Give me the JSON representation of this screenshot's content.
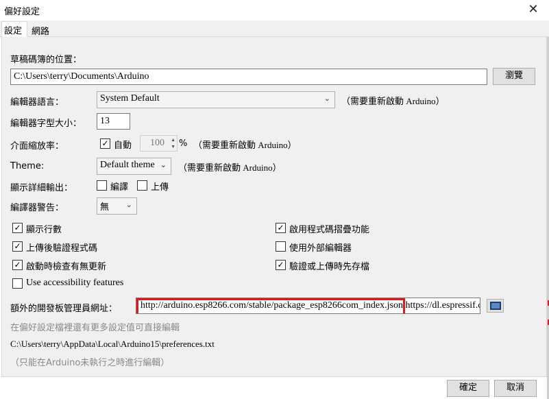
{
  "window": {
    "title": "偏好設定",
    "close_glyph": "✕"
  },
  "tabs": [
    {
      "label": "設定",
      "active": true
    },
    {
      "label": "網路",
      "active": false
    }
  ],
  "sketchbook": {
    "label": "草稿碼簿的位置：",
    "path": "C:\\Users\\terry\\Documents\\Arduino",
    "browse_label": "瀏覽"
  },
  "editor_language": {
    "label": "編輯器語言：",
    "value": "System Default",
    "note": "（需要重新啟動 Arduino）"
  },
  "editor_font_size": {
    "label": "編輯器字型大小：",
    "value": "13"
  },
  "interface_scale": {
    "label": "介面縮放率：",
    "auto_label": "自動",
    "auto_checked": true,
    "value": "100",
    "unit": "%",
    "note": "（需要重新啟動 Arduino）"
  },
  "theme": {
    "label": "Theme:",
    "value": "Default theme",
    "note": "（需要重新啟動 Arduino）"
  },
  "verbose_output": {
    "label": "顯示詳細輸出：",
    "compile_label": "編譯",
    "compile_checked": false,
    "upload_label": "上傳",
    "upload_checked": false
  },
  "compiler_warnings": {
    "label": "編譯器警告：",
    "value": "無"
  },
  "options_left": [
    {
      "label": "顯示行數",
      "checked": true
    },
    {
      "label": "上傳後驗證程式碼",
      "checked": true
    },
    {
      "label": "啟動時檢查有無更新",
      "checked": true
    },
    {
      "label": "Use accessibility features",
      "checked": false
    }
  ],
  "options_right": [
    {
      "label": "啟用程式碼摺疊功能",
      "checked": true
    },
    {
      "label": "使用外部編輯器",
      "checked": false
    },
    {
      "label": "驗證或上傳時先存檔",
      "checked": true
    }
  ],
  "board_urls": {
    "label": "額外的開發板管理員網址：",
    "value": "http://arduino.esp8266.com/stable/package_esp8266com_index.json,https://dl.espressif.c"
  },
  "more_prefs_note": "在偏好設定檔裡還有更多設定值可直接編輯",
  "prefs_path": "C:\\Users\\terry\\AppData\\Local\\Arduino15\\preferences.txt",
  "edit_hint": "（只能在Arduino未執行之時進行編輯）",
  "footer": {
    "ok_label": "確定",
    "cancel_label": "取消"
  },
  "colors": {
    "highlight": "#e0191f",
    "panel_bg": "#f0f0f0"
  }
}
